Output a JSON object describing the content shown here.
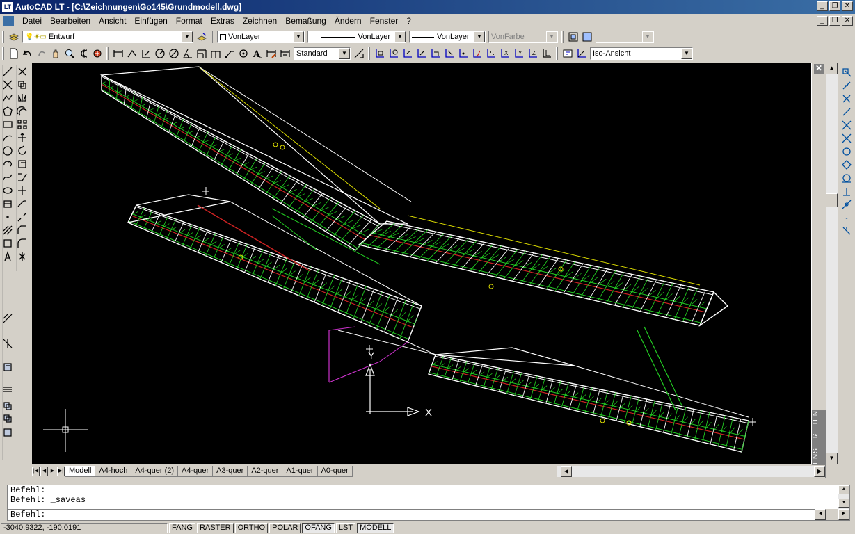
{
  "window": {
    "app_icon": "LT",
    "title": "AutoCAD LT - [C:\\Zeichnungen\\Go145\\Grundmodell.dwg]"
  },
  "menu": [
    "Datei",
    "Bearbeiten",
    "Ansicht",
    "Einfügen",
    "Format",
    "Extras",
    "Zeichnen",
    "Bemaßung",
    "Ändern",
    "Fenster",
    "?"
  ],
  "toolbar1": {
    "layer": "Entwurf",
    "color": "VonLayer",
    "linetype": "VonLayer",
    "lineweight": "VonLayer",
    "plotstyle": "VonFarbe"
  },
  "toolbar2": {
    "dimstyle": "Standard",
    "view": "Iso-Ansicht"
  },
  "properties_panel": {
    "label": "EIGENSCHAFTEN"
  },
  "ucs_icon": {
    "y_label": "Y",
    "x_label": "X"
  },
  "tabs": [
    "Modell",
    "A4-hoch",
    "A4-quer (2)",
    "A4-quer",
    "A3-quer",
    "A2-quer",
    "A1-quer",
    "A0-quer"
  ],
  "command_window": {
    "history": [
      "Befehl:",
      "Befehl: _saveas"
    ],
    "prompt": "Befehl:"
  },
  "status": {
    "coords": "-3040.9322, -190.0191",
    "toggles": [
      "FANG",
      "RASTER",
      "ORTHO",
      "POLAR",
      "OFANG",
      "LST",
      "MODELL"
    ],
    "active": [
      "OFANG",
      "MODELL"
    ]
  },
  "colors": {
    "title_gradient_start": "#0a246a",
    "title_gradient_end": "#3a6ea5",
    "viewport_bg": "#000000",
    "wire_white": "#ffffff",
    "wire_green": "#22cc22",
    "wire_red": "#cc2222",
    "wire_yellow": "#dddd00",
    "wire_magenta": "#cc33cc"
  },
  "icons": {
    "tb1": [
      "layers-manager-icon",
      "layer-state-icons",
      "layer-previous-icon",
      "layer-button-icon",
      "linetype-icon",
      "view-icon"
    ],
    "tb2": [
      "new-icon",
      "open-icon",
      "save-icon",
      "pan-icon",
      "zoom-icon",
      "properties-icon",
      "dimension-icons",
      "text-style-icon"
    ],
    "left_draw": [
      "line-icon",
      "xline-icon",
      "polyline-icon",
      "polygon-icon",
      "rectangle-icon",
      "arc-icon",
      "circle-icon",
      "revcloud-icon",
      "spline-icon",
      "ellipse-icon",
      "block-icon",
      "point-icon",
      "hatch-icon",
      "region-icon",
      "text-icon"
    ],
    "left_modify": [
      "erase-icon",
      "copy-icon",
      "mirror-icon",
      "offset-icon",
      "array-icon",
      "move-icon",
      "rotate-icon",
      "scale-icon",
      "stretch-icon",
      "trim-icon",
      "extend-icon",
      "break-icon",
      "chamfer-icon",
      "fillet-icon",
      "explode-icon"
    ],
    "right_snap": [
      "snap-endpoint-icon",
      "snap-midpoint-icon",
      "snap-intersection-icon",
      "snap-extension-icon",
      "snap-center-icon",
      "snap-quadrant-icon",
      "snap-tangent-icon",
      "snap-perpendicular-icon",
      "snap-parallel-icon",
      "snap-node-icon",
      "snap-nearest-icon",
      "snap-none-icon",
      "snap-settings-icon"
    ]
  }
}
